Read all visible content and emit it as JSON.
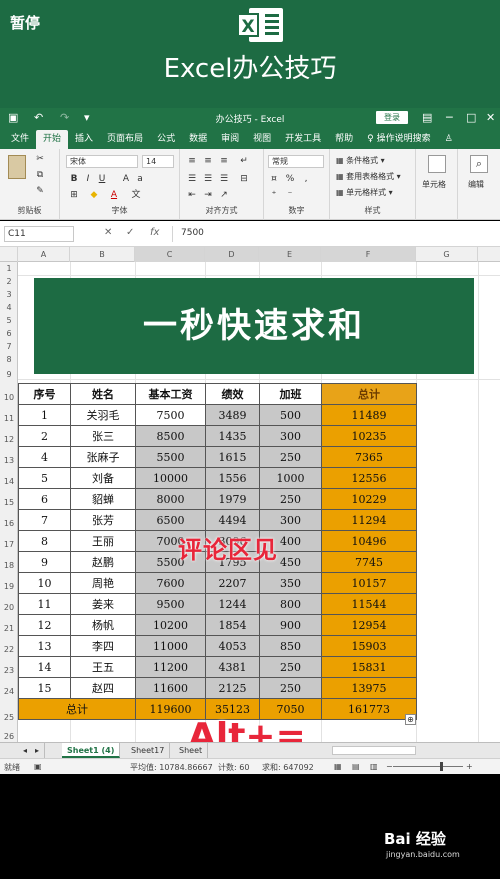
{
  "overlay": {
    "pause_label": "暂停",
    "comment_caption": "评论区见",
    "shortcut_caption": "Alt+="
  },
  "banner": {
    "title": "Excel办公技巧",
    "logo_letter": "X"
  },
  "titlebar": {
    "doc_title": "办公技巧 - Excel",
    "login_label": "登录"
  },
  "ribbon": {
    "tabs": [
      "文件",
      "开始",
      "插入",
      "页面布局",
      "公式",
      "数据",
      "审阅",
      "视图",
      "开发工具",
      "帮助",
      "操作说明搜索"
    ],
    "active_tab": "开始",
    "font_name": "宋体",
    "font_size": "14",
    "number_format": "常规",
    "cond_format": "条件格式",
    "table_format": "套用表格格式",
    "cell_style": "单元格样式",
    "cells_label": "单元格",
    "edit_label": "编辑",
    "groups": {
      "clipboard": "剪贴板",
      "font": "字体",
      "align": "对齐方式",
      "number": "数字",
      "style": "样式"
    }
  },
  "formula_bar": {
    "cell_ref": "C11",
    "value": "7500"
  },
  "grid": {
    "columns": [
      "A",
      "B",
      "C",
      "D",
      "E",
      "F",
      "G"
    ],
    "rows": [
      "1",
      "2",
      "3",
      "4",
      "5",
      "6",
      "7",
      "8",
      "9",
      "10",
      "11",
      "12",
      "13",
      "14",
      "15",
      "16",
      "17",
      "18",
      "19",
      "20",
      "21",
      "22",
      "23",
      "24",
      "25",
      "26"
    ],
    "banner_title": "一秒快速求和"
  },
  "table": {
    "headers": [
      "序号",
      "姓名",
      "基本工资",
      "绩效",
      "加班",
      "总计"
    ],
    "rows": [
      [
        "1",
        "关羽毛",
        "7500",
        "3489",
        "500",
        "11489"
      ],
      [
        "2",
        "张三",
        "8500",
        "1435",
        "300",
        "10235"
      ],
      [
        "4",
        "张麻子",
        "5500",
        "1615",
        "250",
        "7365"
      ],
      [
        "5",
        "刘备",
        "10000",
        "1556",
        "1000",
        "12556"
      ],
      [
        "6",
        "貂蝉",
        "8000",
        "1979",
        "250",
        "10229"
      ],
      [
        "7",
        "张芳",
        "6500",
        "4494",
        "300",
        "11294"
      ],
      [
        "8",
        "王丽",
        "7000",
        "3096",
        "400",
        "10496"
      ],
      [
        "9",
        "赵鹏",
        "5500",
        "1795",
        "450",
        "7745"
      ],
      [
        "10",
        "周艳",
        "7600",
        "2207",
        "350",
        "10157"
      ],
      [
        "11",
        "姜来",
        "9500",
        "1244",
        "800",
        "11544"
      ],
      [
        "12",
        "杨帆",
        "10200",
        "1854",
        "900",
        "12954"
      ],
      [
        "13",
        "李四",
        "11000",
        "4053",
        "850",
        "15903"
      ],
      [
        "14",
        "王五",
        "11200",
        "4381",
        "250",
        "15831"
      ],
      [
        "15",
        "赵四",
        "11600",
        "2125",
        "250",
        "13975"
      ]
    ],
    "total_label": "总计",
    "totals": [
      "119600",
      "35123",
      "7050",
      "161773"
    ]
  },
  "sheets": {
    "tabs": [
      "Sheet1 (4)",
      "Sheet17",
      "Sheet"
    ],
    "active": "Sheet1 (4)"
  },
  "status": {
    "mode": "就绪",
    "average": "平均值: 10784.86667",
    "count": "计数: 60",
    "sum": "求和: 647092"
  },
  "watermark": {
    "brand": "Bai 经验",
    "url": "jingyan.baidu.com"
  }
}
